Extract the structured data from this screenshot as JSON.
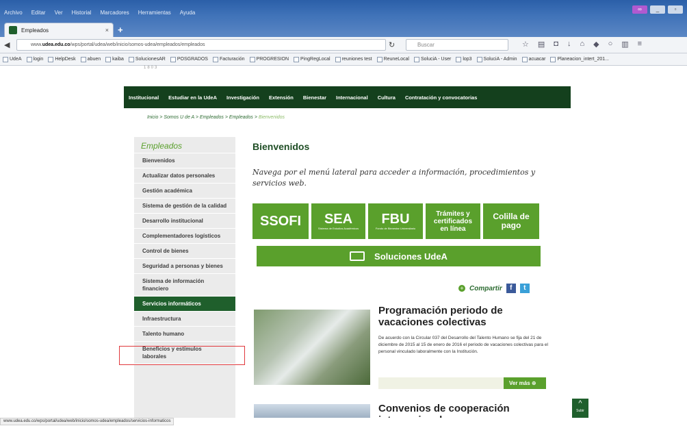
{
  "browser": {
    "menu": [
      "Archivo",
      "Editar",
      "Ver",
      "Historial",
      "Marcadores",
      "Herramientas",
      "Ayuda"
    ],
    "tab_title": "Empleados",
    "url_prefix": "www.",
    "url_domain": "udea.edu.co",
    "url_rest": "/wps/portal/udea/web/inicio/somos-udea/empleados/empleados",
    "search_placeholder": "Buscar",
    "bookmarks": [
      "UdeA",
      "login",
      "HelpDesk",
      "abuen",
      "kaiba",
      "SolucionesAR",
      "POSGRADOS",
      "Facturación",
      "PROGRESION",
      "PingRegLocal",
      "reuniones test",
      "ReuneLocal",
      "SoluciA - User",
      "lop3",
      "SoluciA - Admin",
      "acuacar",
      "Planeacion_intert_201..."
    ],
    "status_url": "www.udea.edu.co/wps/portal/udea/web/inicio/somos-udea/empleados/servicios-informaticos"
  },
  "site": {
    "logo_text": "1803",
    "nav": [
      "Institucional",
      "Estudiar en la UdeA",
      "Investigación",
      "Extensión",
      "Bienestar",
      "Internacional",
      "Cultura",
      "Contratación y convocatorias"
    ],
    "breadcrumb": "Inicio > Somos U de A > Empleados > Empleados > ",
    "breadcrumb_last": "Bienvenidos"
  },
  "sidebar": {
    "title": "Empleados",
    "items": [
      "Bienvenidos",
      "Actualizar datos personales",
      "Gestión académica",
      "Sistema de gestión de la calidad",
      "Desarrollo institucional",
      "Complementadores logísticos",
      "Control de bienes",
      "Seguridad a personas y bienes",
      "Sistema de información financiero",
      "Servicios informáticos",
      "Infraestructura",
      "Talento humano",
      "Beneficios y estímulos laborales"
    ],
    "active_index": 9
  },
  "main": {
    "title": "Bienvenidos",
    "intro": "Navega por el menú lateral para acceder a información, procedimientos y servicios web.",
    "tiles": [
      {
        "big": "SSOFI",
        "small": ""
      },
      {
        "big": "SEA",
        "small": "Sistema de Estudios Académicos"
      },
      {
        "big": "FBU",
        "small": "Fondo de Bienestar Universitario"
      },
      {
        "med": "Trámites y certificados en línea"
      },
      {
        "med": "Colilla de pago"
      }
    ],
    "solutions_label": "Soluciones UdeA",
    "share_label": "Compartir",
    "facebook": "f",
    "twitter": "t",
    "news": [
      {
        "title": "Programación periodo de vacaciones colectivas",
        "body": "De acuerdo con la Circular 037 del Desarrollo del Talento Humano se fija del 21 de diciembre de 2015 al 15 de enero de 2016 el periodo de vacaciones colectivas para el personal vinculado laboralmente con la Institución.",
        "more": "Ver más"
      },
      {
        "title": "Convenios de cooperación internacional"
      }
    ],
    "up_label": "Subir"
  },
  "colors": {
    "dark_green": "#14401d",
    "accent_green": "#5aa02c",
    "highlight_red": "#e0373b"
  }
}
